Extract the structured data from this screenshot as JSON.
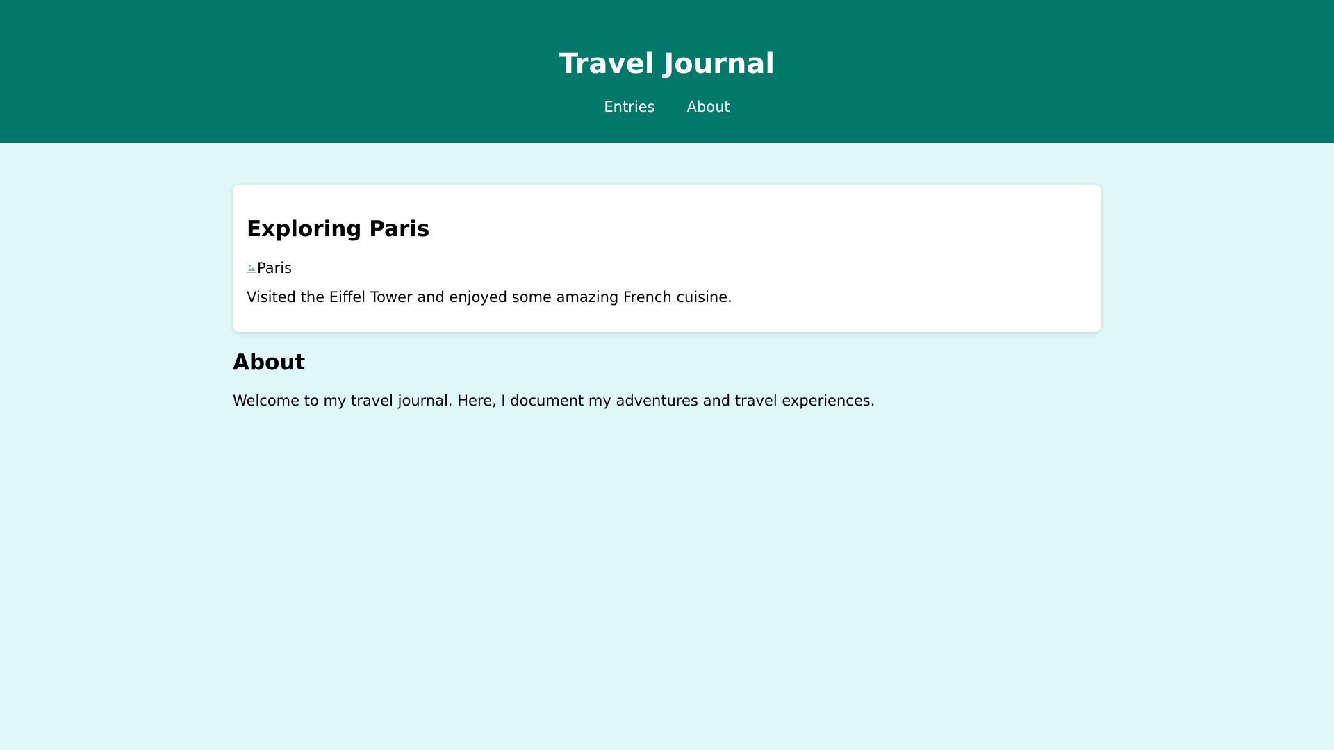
{
  "header": {
    "title": "Travel Journal",
    "nav": [
      {
        "label": "Entries"
      },
      {
        "label": "About"
      }
    ],
    "background_color": "#00796b"
  },
  "entries": [
    {
      "title": "Exploring Paris",
      "image_alt": "Paris",
      "description": "Visited the Eiffel Tower and enjoyed some amazing French cuisine."
    }
  ],
  "about": {
    "title": "About",
    "text": "Welcome to my travel journal. Here, I document my adventures and travel experiences."
  },
  "page_background_color": "#e0f7f8"
}
